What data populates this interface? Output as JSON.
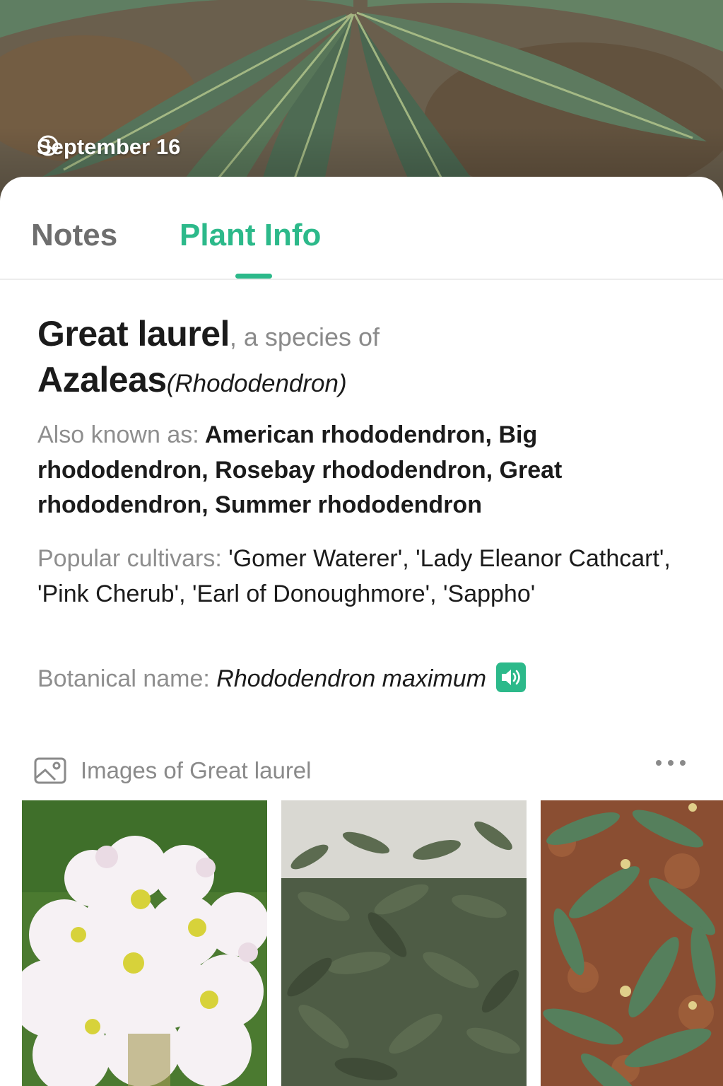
{
  "header": {
    "date": "September 16",
    "clock_icon": "clock-icon"
  },
  "tabs": [
    {
      "label": "Notes",
      "active": false
    },
    {
      "label": "Plant Info",
      "active": true
    }
  ],
  "plant": {
    "common_name": "Great laurel",
    "species_connector": ", a species of",
    "genus_common": "Azaleas",
    "genus_scientific": "(Rhododendron)",
    "aka_label": "Also known as:",
    "aka_value": "American rhododendron, Big rhododendron, Rosebay rhododendron, Great rhododendron, Summer rhododendron",
    "cultivars_label": "Popular cultivars:",
    "cultivars_value": "'Gomer Waterer', 'Lady Eleanor Cathcart', 'Pink Cherub', 'Earl of Donoughmore', 'Sappho'",
    "botanical_label": "Botanical name:",
    "botanical_value": "Rhododendron maximum"
  },
  "images": {
    "heading": "Images of Great laurel",
    "items": [
      {
        "subject": "white flower cluster"
      },
      {
        "subject": "shrub foliage"
      },
      {
        "subject": "leaf rosettes"
      }
    ]
  },
  "colors": {
    "accent": "#2cb98a",
    "text": "#1b1b1b",
    "muted": "#8a8a8a"
  }
}
